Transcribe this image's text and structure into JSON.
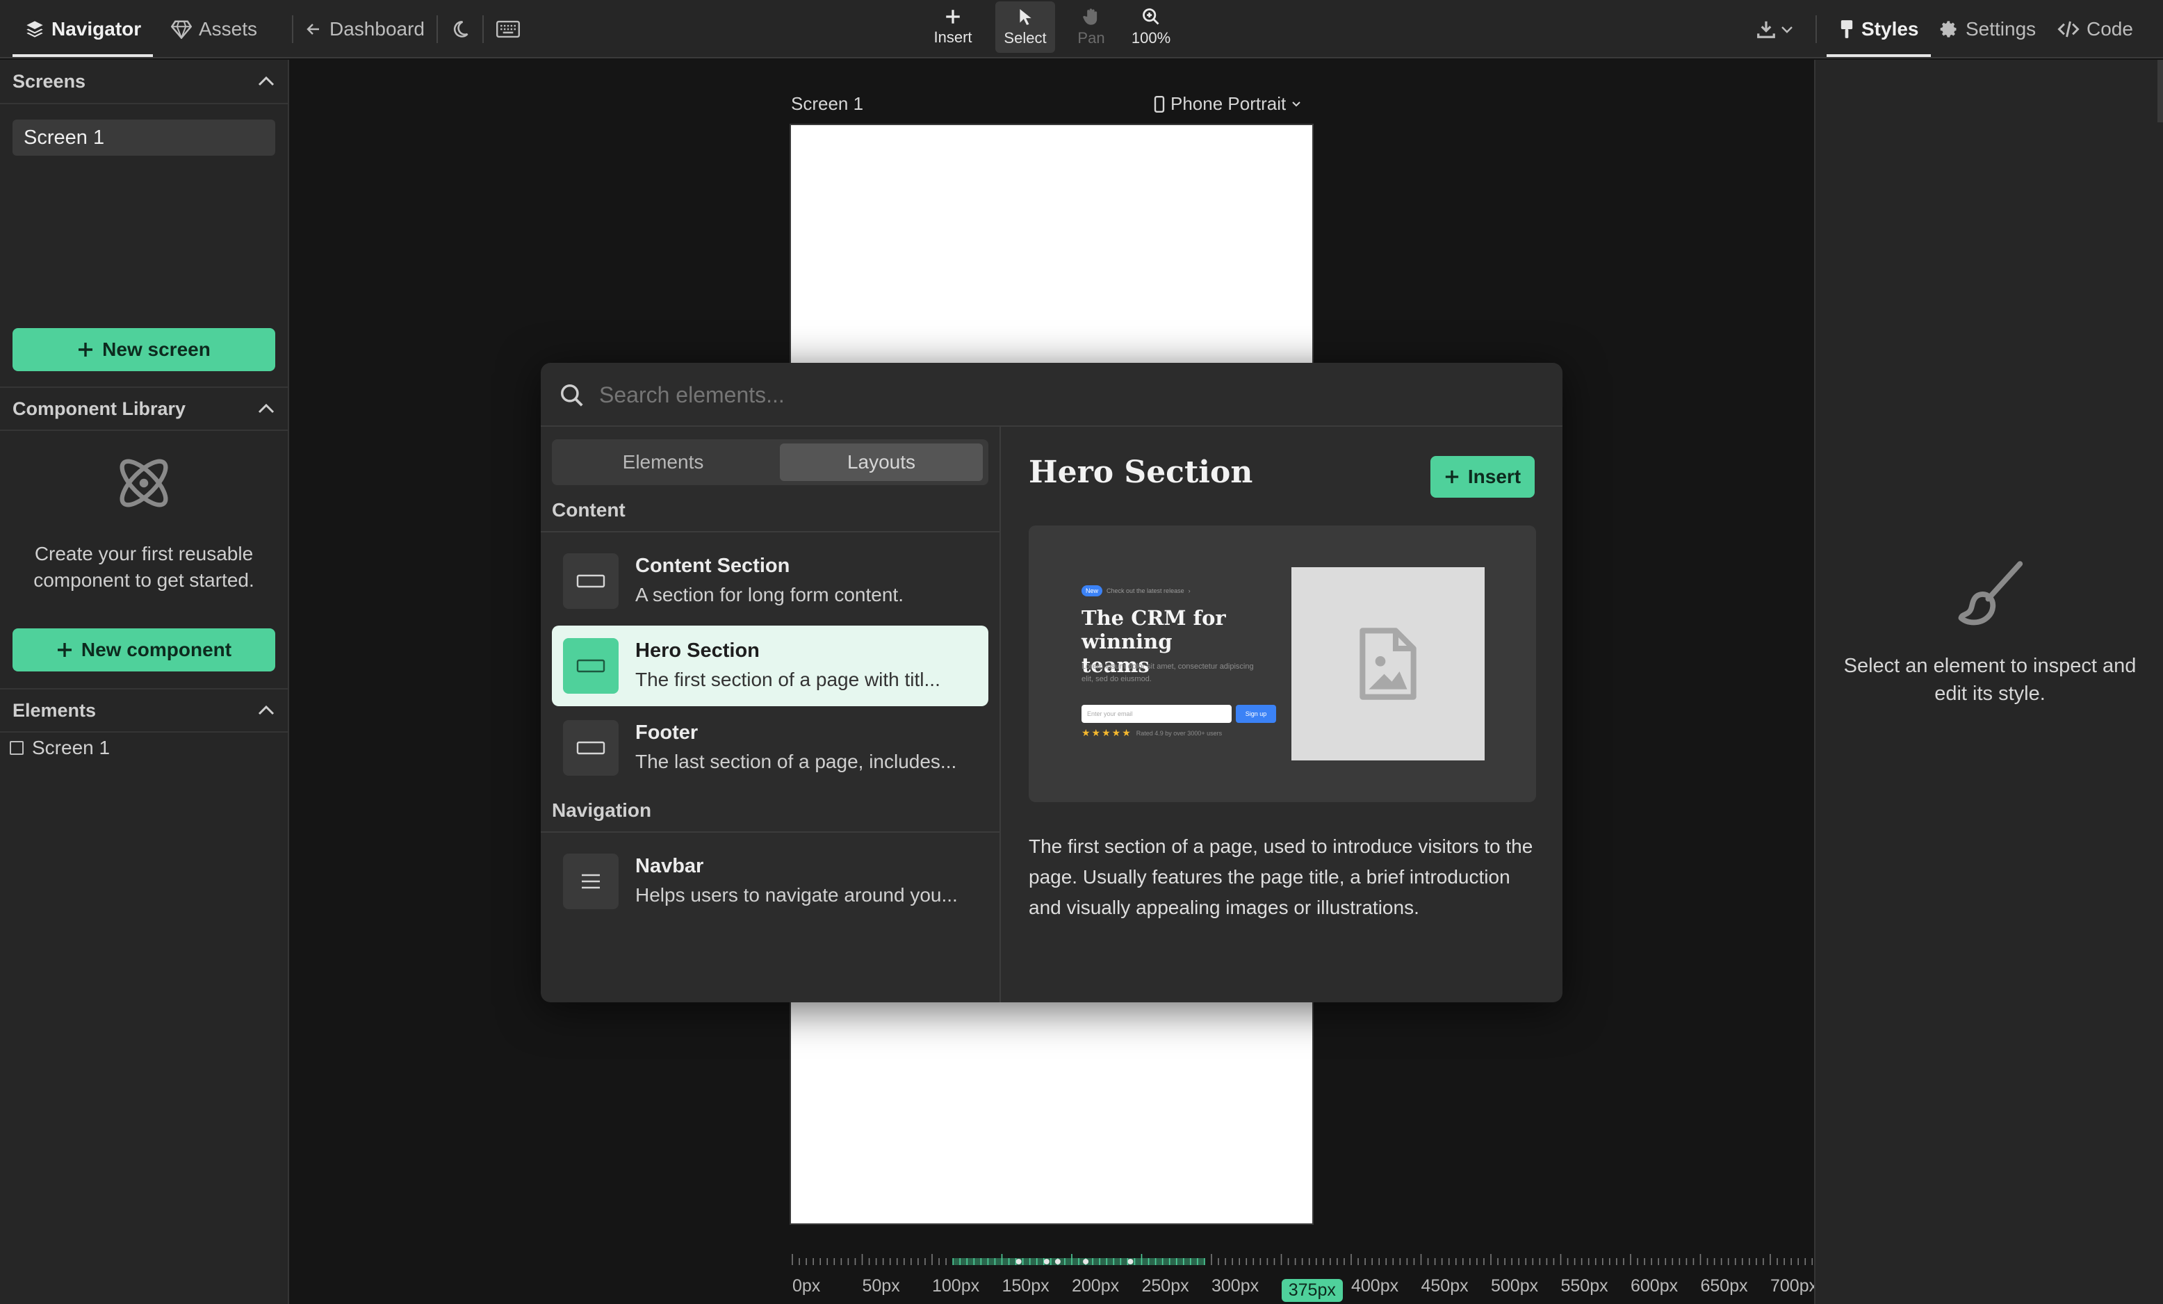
{
  "topbar": {
    "left_tabs": [
      {
        "label": "Navigator",
        "icon": "layers-icon",
        "active": true
      },
      {
        "label": "Assets",
        "icon": "gem-icon",
        "active": false
      }
    ],
    "dashboard_label": "Dashboard",
    "tools": [
      {
        "label": "Insert",
        "icon": "plus-icon"
      },
      {
        "label": "Select",
        "icon": "cursor-icon"
      },
      {
        "label": "Pan",
        "icon": "hand-icon"
      },
      {
        "label": "100%",
        "icon": "zoom-icon"
      }
    ],
    "right_tabs": [
      {
        "label": "Styles",
        "icon": "paint-icon",
        "active": true
      },
      {
        "label": "Settings",
        "icon": "gear-icon",
        "active": false
      },
      {
        "label": "Code",
        "icon": "code-icon",
        "active": false
      }
    ]
  },
  "left": {
    "screens": {
      "title": "Screens",
      "items": [
        "Screen 1"
      ],
      "new_button": "New screen"
    },
    "library": {
      "title": "Component Library",
      "empty_text": "Create your first reusable component to get started.",
      "new_button": "New component"
    },
    "elements": {
      "title": "Elements",
      "items": [
        "Screen 1"
      ]
    }
  },
  "canvas": {
    "screen_name": "Screen 1",
    "device": "Phone Portrait"
  },
  "ruler": {
    "labels": [
      "0px",
      "50px",
      "100px",
      "150px",
      "200px",
      "250px",
      "300px",
      "375px",
      "400px",
      "450px",
      "500px",
      "550px",
      "600px",
      "650px",
      "700px"
    ],
    "current": "375px"
  },
  "modal": {
    "search_placeholder": "Search elements...",
    "tabs": [
      {
        "label": "Elements",
        "active": false
      },
      {
        "label": "Layouts",
        "active": true
      }
    ],
    "groups": [
      {
        "title": "Content",
        "items": [
          {
            "title": "Content Section",
            "desc": "A section for long form content.",
            "selected": false
          },
          {
            "title": "Hero Section",
            "desc": "The first section of a page with titl...",
            "selected": true
          },
          {
            "title": "Footer",
            "desc": "The last section of a page, includes...",
            "selected": false
          }
        ]
      },
      {
        "title": "Navigation",
        "items": [
          {
            "title": "Navbar",
            "desc": "Helps users to navigate around you...",
            "selected": false
          }
        ]
      }
    ],
    "detail": {
      "title": "Hero Section",
      "insert_label": "Insert",
      "description": "The first section of a page, used to introduce visitors to the page. Usually features the page title, a brief introduction and visually appealing images or illustrations.",
      "preview": {
        "badge": "New",
        "badge_text": "Check out the latest release",
        "headline": "The CRM for winning teams",
        "body": "Lorem ipsum dolor sit amet, consectetur adipiscing elit, sed do eiusmod.",
        "input_placeholder": "Enter your email",
        "button": "Sign up",
        "rating_text": "Rated 4.9 by over 3000+ users",
        "rating": 4.5
      }
    }
  },
  "right": {
    "empty_text": "Select an element to inspect and edit its style."
  },
  "colors": {
    "accent": "#4fd19b",
    "panel": "#262626",
    "canvas": "#151515",
    "modal": "#2c2c2c"
  }
}
